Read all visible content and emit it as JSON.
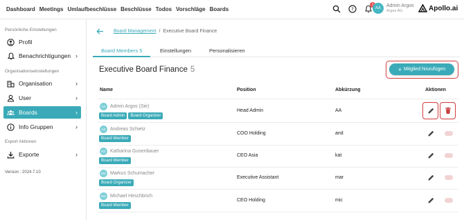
{
  "nav": [
    "Dashboard",
    "Meetings",
    "Umlaufbeschlüsse",
    "Beschlüsse",
    "Todos",
    "Vorschläge",
    "Boards"
  ],
  "header": {
    "notification_count": "1",
    "user_initials": "AA",
    "user_name": "Admin Argos",
    "user_company": "Argos AG",
    "logo_text": "Apollo.ai"
  },
  "sidebar": {
    "section_personal": "Persönliche Einstellungen",
    "section_org": "Organisationseinstellungen",
    "section_export": "Export Aktionen",
    "items": [
      {
        "label": "Profil",
        "icon": "user-circle-icon"
      },
      {
        "label": "Benachrichtigungen",
        "icon": "bell-icon"
      },
      {
        "label": "Organisation",
        "icon": "building-icon"
      },
      {
        "label": "User",
        "icon": "person-icon"
      },
      {
        "label": "Boards",
        "icon": "group-icon"
      },
      {
        "label": "Info Gruppen",
        "icon": "info-icon"
      },
      {
        "label": "Exporte",
        "icon": "download-icon"
      }
    ],
    "version": "Version : 2024.7.10"
  },
  "breadcrumb": {
    "link": "Board Management",
    "separator": "/",
    "current": "Executive Board Finance"
  },
  "tabs": [
    "Board Members 5",
    "Einstellungen",
    "Personalisieren"
  ],
  "page": {
    "title": "Executive Board Finance",
    "count": "5",
    "add_button": "Mitglied hinzufügen"
  },
  "table": {
    "headers": [
      "Name",
      "Position",
      "Abkürzung",
      "Aktionen"
    ],
    "rows": [
      {
        "initials": "AA",
        "name": "Admin Argos (Sie)",
        "tags": [
          "Board Admin",
          "Board Organizer"
        ],
        "position": "Head Admin",
        "abbr": "AA"
      },
      {
        "initials": "AS",
        "name": "Andreas Schietz",
        "tags": [
          "Board Member"
        ],
        "position": "COO Holding",
        "abbr": "and"
      },
      {
        "initials": "KG",
        "name": "Katharina Gusenbauer",
        "tags": [
          "Board Member"
        ],
        "position": "CEO Asia",
        "abbr": "kat"
      },
      {
        "initials": "MS",
        "name": "Markus Schumacher",
        "tags": [
          "Board Organizer"
        ],
        "position": "Executive Assistant",
        "abbr": "mar"
      },
      {
        "initials": "MH",
        "name": "Michael Hirschbrich",
        "tags": [
          "Board Member"
        ],
        "position": "CEO Holding",
        "abbr": "mic"
      }
    ]
  },
  "colors": {
    "accent": "#3aaab8",
    "highlight": "#d23b3b",
    "delete": "#c94040"
  }
}
